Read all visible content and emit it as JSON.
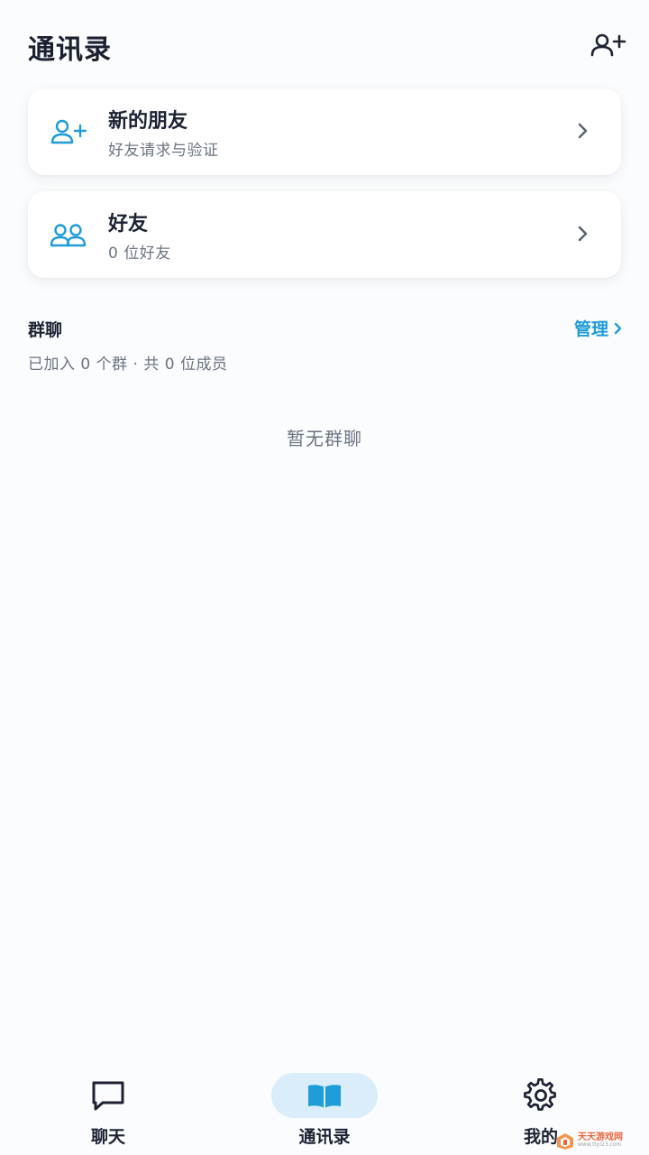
{
  "header": {
    "title": "通讯录",
    "add_icon": "person-add-icon"
  },
  "cards": {
    "new_friends": {
      "title": "新的朋友",
      "subtitle": "好友请求与验证",
      "icon": "person-add-icon"
    },
    "friends": {
      "title": "好友",
      "subtitle": "0 位好友",
      "icon": "people-icon"
    }
  },
  "groups": {
    "title": "群聊",
    "manage_label": "管理",
    "stats": "已加入 0 个群 · 共 0 位成员",
    "empty_text": "暂无群聊"
  },
  "nav": {
    "items": [
      {
        "label": "聊天",
        "icon": "chat-bubble-icon",
        "active": false
      },
      {
        "label": "通讯录",
        "icon": "book-icon",
        "active": true
      },
      {
        "label": "我的",
        "icon": "gear-icon",
        "active": false
      }
    ]
  },
  "watermark": {
    "cn": "天天游戏网",
    "en": "www.ttyl23.com"
  },
  "colors": {
    "accent": "#1e9cd7",
    "active_nav_bg": "#d9eefa",
    "text_primary": "#1c2232",
    "text_secondary": "#6b7482",
    "background": "#fbfcfd"
  }
}
